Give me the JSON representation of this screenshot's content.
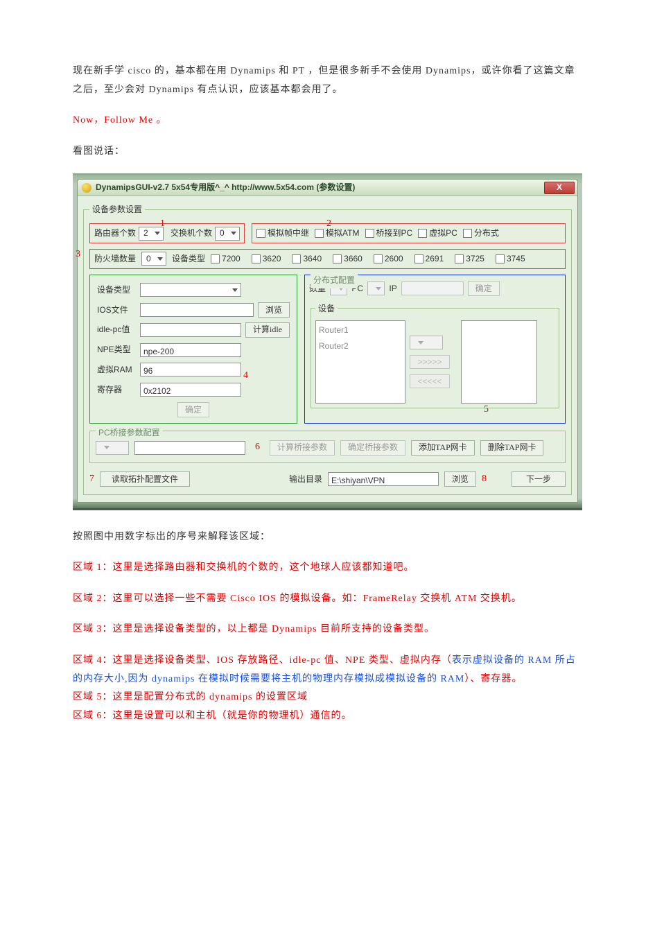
{
  "intro": {
    "p1": "现在新手学 cisco 的，基本都在用 Dynamips 和 PT ，但是很多新手不会使用 Dynamips，或许你看了这篇文章之后，至少会对 Dynamips 有点认识，应该基本都会用了。",
    "p2": "Now，Follow Me 。",
    "p3": "看图说话："
  },
  "window": {
    "title": "DynamipsGUI-v2.7 5x54专用版^_^ http://www.5x54.com (参数设置)",
    "close_icon_text": "X"
  },
  "main_fieldset_legend": "设备参数设置",
  "section1": {
    "router_label": "路由器个数",
    "router_value": "2",
    "switch_label": "交换机个数",
    "switch_value": "0"
  },
  "section2_checks": [
    "模拟帧中继",
    "模拟ATM",
    "桥接到PC",
    "虚拟PC",
    "分布式"
  ],
  "section3": {
    "firewall_label": "防火墙数量",
    "firewall_value": "0",
    "devtype_label": "设备类型",
    "options": [
      "7200",
      "3620",
      "3640",
      "3660",
      "2600",
      "2691",
      "3725",
      "3745"
    ]
  },
  "left_form": {
    "devtype_label": "设备类型",
    "ios_label": "IOS文件",
    "browse": "浏览",
    "idle_label": "idle-pc值",
    "calc_idle": "计算idle",
    "npe_label": "NPE类型",
    "npe_value": "npe-200",
    "ram_label": "虚拟RAM",
    "ram_value": "96",
    "reg_label": "寄存器",
    "reg_value": "0x2102",
    "confirm": "确定"
  },
  "dist": {
    "group_title": "分布式配置",
    "qty_label": "数量",
    "pc_label": "PC",
    "ip_label": "IP",
    "confirm": "确定",
    "dev_group": "设备",
    "routers": [
      "Router1",
      "Router2"
    ],
    "xfer1": ">>>>>",
    "xfer2": "<<<<<"
  },
  "pc_bridge": {
    "legend": "PC桥接参数配置",
    "calc": "计算桥接参数",
    "confirm_bridge": "确定桥接参数",
    "add_tap": "添加TAP网卡",
    "del_tap": "删除TAP网卡"
  },
  "bottom": {
    "read_topo": "读取拓扑配置文件",
    "out_label": "输出目录",
    "out_value": "E:\\shiyan\\VPN",
    "browse": "浏览",
    "next": "下一步"
  },
  "annotations": {
    "a1": "1",
    "a2": "2",
    "a3": "3",
    "a4": "4",
    "a5": "5",
    "a6": "6",
    "a7": "7",
    "a8": "8"
  },
  "explain_intro": "按照图中用数字标出的序号来解释该区域：",
  "zones": {
    "z1": "区域 1：这里是选择路由器和交换机的个数的，这个地球人应该都知道吧。",
    "z2": "区域 2：这里可以选择一些不需要 Cisco IOS 的模拟设备。如：FrameRelay 交换机 ATM 交换机。",
    "z3": "区域 3：这里是选择设备类型的，以上都是 Dynamips 目前所支持的设备类型。",
    "z4a": "区域 4：这里是选择设备类型、IOS 存放路径、idle-pc 值、NPE 类型、虚拟内存（",
    "z4b": "表示虚拟设备的 RAM 所占的内存大小,因为 dynamips 在模拟时候需要将主机的物理内存模拟成模拟设备的 RAM",
    "z4c": "）、寄存器。",
    "z5": "区域 5：这里是配置分布式的 dynamips 的设置区域",
    "z6": "区域 6：这里是设置可以和主机（就是你的物理机）通信的。"
  }
}
